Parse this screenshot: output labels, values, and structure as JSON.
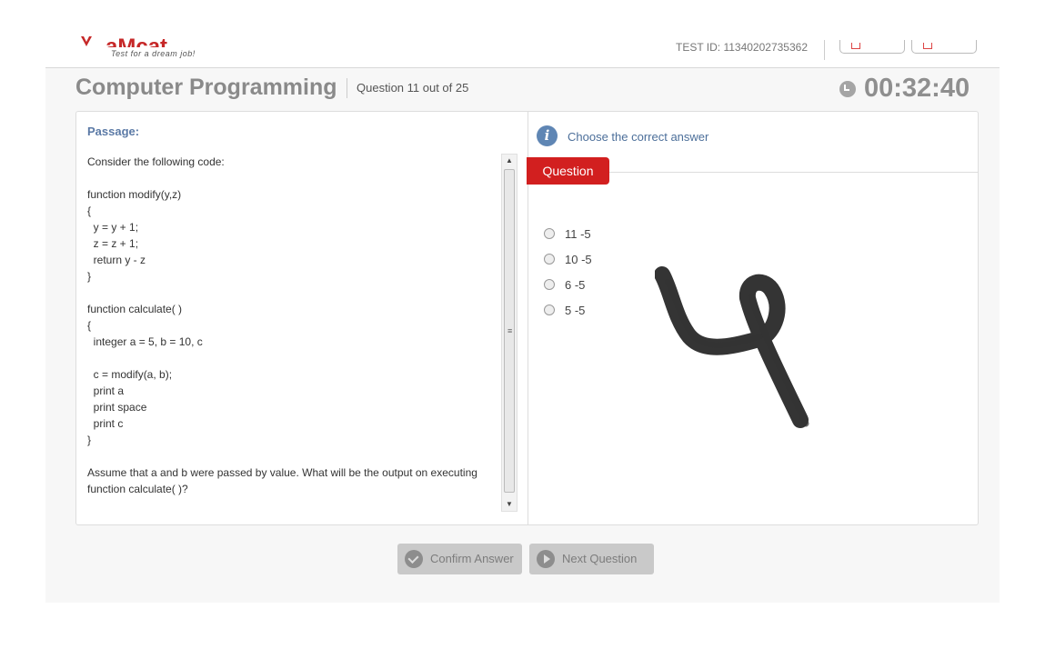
{
  "header": {
    "logo_text": "aMcat",
    "tagline": "Test for a dream job!",
    "test_id": "TEST ID: 11340202735362"
  },
  "exam": {
    "title": "Computer Programming",
    "question_count": "Question 11 out of 25",
    "timer": "00:32:40"
  },
  "passage": {
    "label": "Passage:",
    "text": "Consider the following code:\n\nfunction modify(y,z)\n{\n  y = y + 1;\n  z = z + 1;\n  return y - z\n}\n\nfunction calculate( )\n{\n  integer a = 5, b = 10, c\n\n  c = modify(a, b);\n  print a\n  print space\n  print c\n}\n\nAssume that a and b were passed by value. What will be the output on executing\nfunction calculate( )?"
  },
  "question": {
    "instruction": "Choose the correct answer",
    "tab_label": "Question",
    "options": [
      {
        "label": "11 -5"
      },
      {
        "label": "10 -5"
      },
      {
        "label": "6 -5"
      },
      {
        "label": "5 -5"
      }
    ]
  },
  "footer": {
    "confirm_label": "Confirm Answer",
    "next_label": "Next Question"
  },
  "colors": {
    "accent_red": "#d21f1f",
    "info_blue": "#5f86b4",
    "title_gray": "#8a8a8a"
  }
}
